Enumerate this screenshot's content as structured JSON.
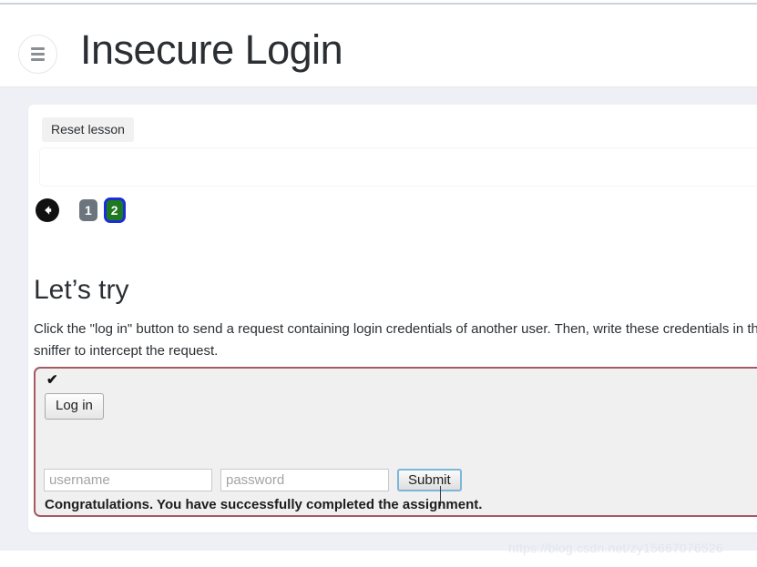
{
  "header": {
    "title": "Insecure Login",
    "menu_icon": "hamburger-icon"
  },
  "lesson": {
    "reset_label": "Reset lesson",
    "pager": {
      "back_icon": "arrow-left-circle-icon",
      "pages": [
        {
          "label": "1",
          "state": "muted"
        },
        {
          "label": "2",
          "state": "active"
        }
      ]
    },
    "heading": "Let’s try",
    "description": "Click the \"log in\" button to send a request containing login credentials of another user. Then, write these credentials in the form below. Use a packet sniffer to intercept the request.",
    "assignment": {
      "status_icon": "check-mark-icon",
      "status_glyph": "✔",
      "login_label": "Log in",
      "username_placeholder": "username",
      "username_value": "",
      "password_placeholder": "password",
      "password_value": "",
      "submit_label": "Submit",
      "result_message": "Congratulations. You have successfully completed the assignment."
    }
  },
  "watermark": {
    "text": "https://blog.csdn.net/zy15667076526"
  },
  "colors": {
    "page_bg": "#eef0f5",
    "card_bg": "#ffffff",
    "assignment_border": "#a45b62",
    "assignment_bg": "#f0f0f0",
    "badge_active": "#1f7a1f",
    "badge_active_outline": "#1a2fd6",
    "badge_muted": "#6c757d",
    "submit_focus_ring": "#7eb6d9"
  }
}
